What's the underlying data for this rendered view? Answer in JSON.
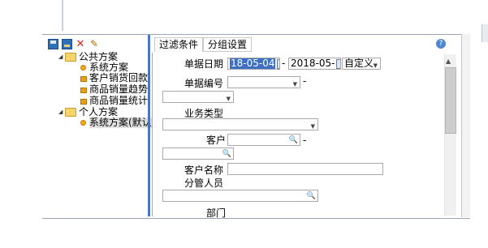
{
  "toolbar": {
    "icons": [
      "save-icon",
      "save-as-icon",
      "delete-icon",
      "edit-icon"
    ]
  },
  "tree": {
    "public_group": "公共方案",
    "public_items": [
      "系统方案",
      "客户销货回款",
      "商品销量趋势",
      "商品销量统计"
    ],
    "private_group": "个人方案",
    "private_items": [
      "系统方案(默认"
    ]
  },
  "tabs": [
    "过滤条件",
    "分组设置"
  ],
  "form": {
    "doc_date_label": "单据日期",
    "date_from": "18-05-04",
    "date_to": "2018-05-",
    "date_range_option": "自定义",
    "doc_no_label": "单据编号",
    "doc_no_from": "",
    "doc_no_to": "",
    "business_type_label": "业务类型",
    "business_type_value": "",
    "customer_label": "客户",
    "customer_from": "",
    "customer_to": "",
    "customer_name_label": "客户名称",
    "customer_name_value": "",
    "manager_label": "分管人员",
    "manager_value": "",
    "department_label": "部门",
    "range_separator": "-"
  },
  "colors": {
    "splitter": "#4a78b8",
    "selected_date_bg": "#3d6fc4",
    "folder": "#f6d36b"
  }
}
